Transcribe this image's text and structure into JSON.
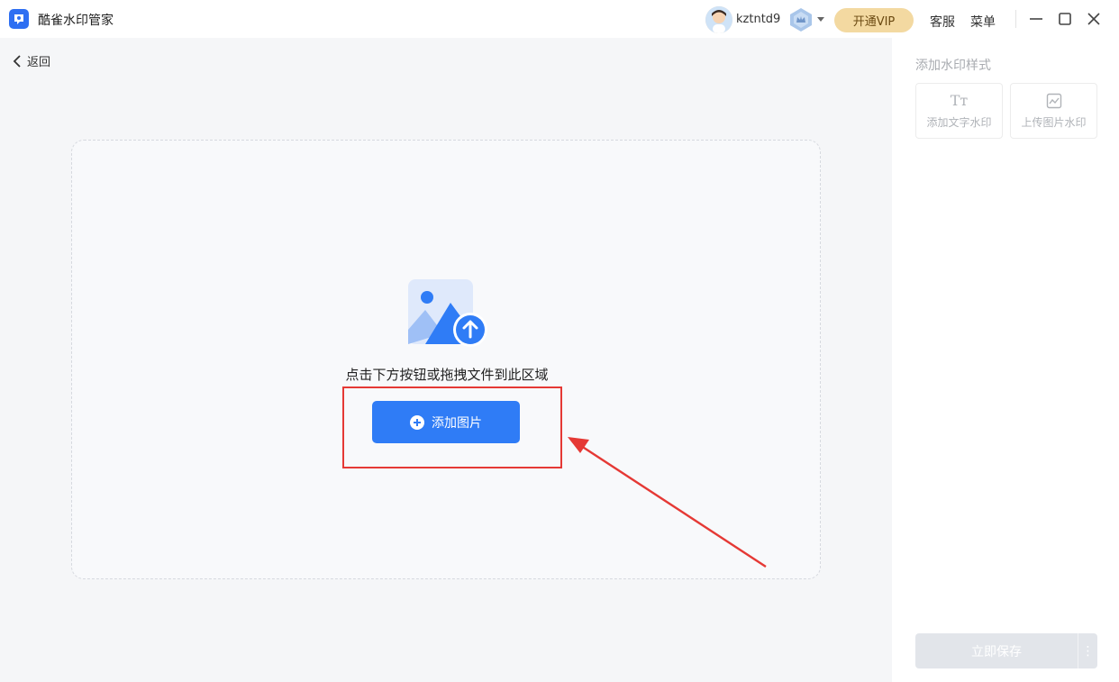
{
  "app": {
    "title": "酷雀水印管家"
  },
  "user": {
    "name": "kztntd9"
  },
  "header": {
    "vip_label": "开通VIP",
    "service_label": "客服",
    "menu_label": "菜单"
  },
  "main": {
    "back_label": "返回",
    "dropzone": {
      "hint": "点击下方按钮或拖拽文件到此区域",
      "add_label": "添加图片"
    }
  },
  "sidebar": {
    "title": "添加水印样式",
    "tools": [
      {
        "label": "添加文字水印",
        "icon": "text-style-icon",
        "glyph": "Tт"
      },
      {
        "label": "上传图片水印",
        "icon": "image-icon"
      }
    ],
    "save_label": "立即保存",
    "more_glyph": "⋮"
  },
  "colors": {
    "primary": "#2f7cf6",
    "vip": "#f3d9a1",
    "highlight": "#e53935"
  }
}
